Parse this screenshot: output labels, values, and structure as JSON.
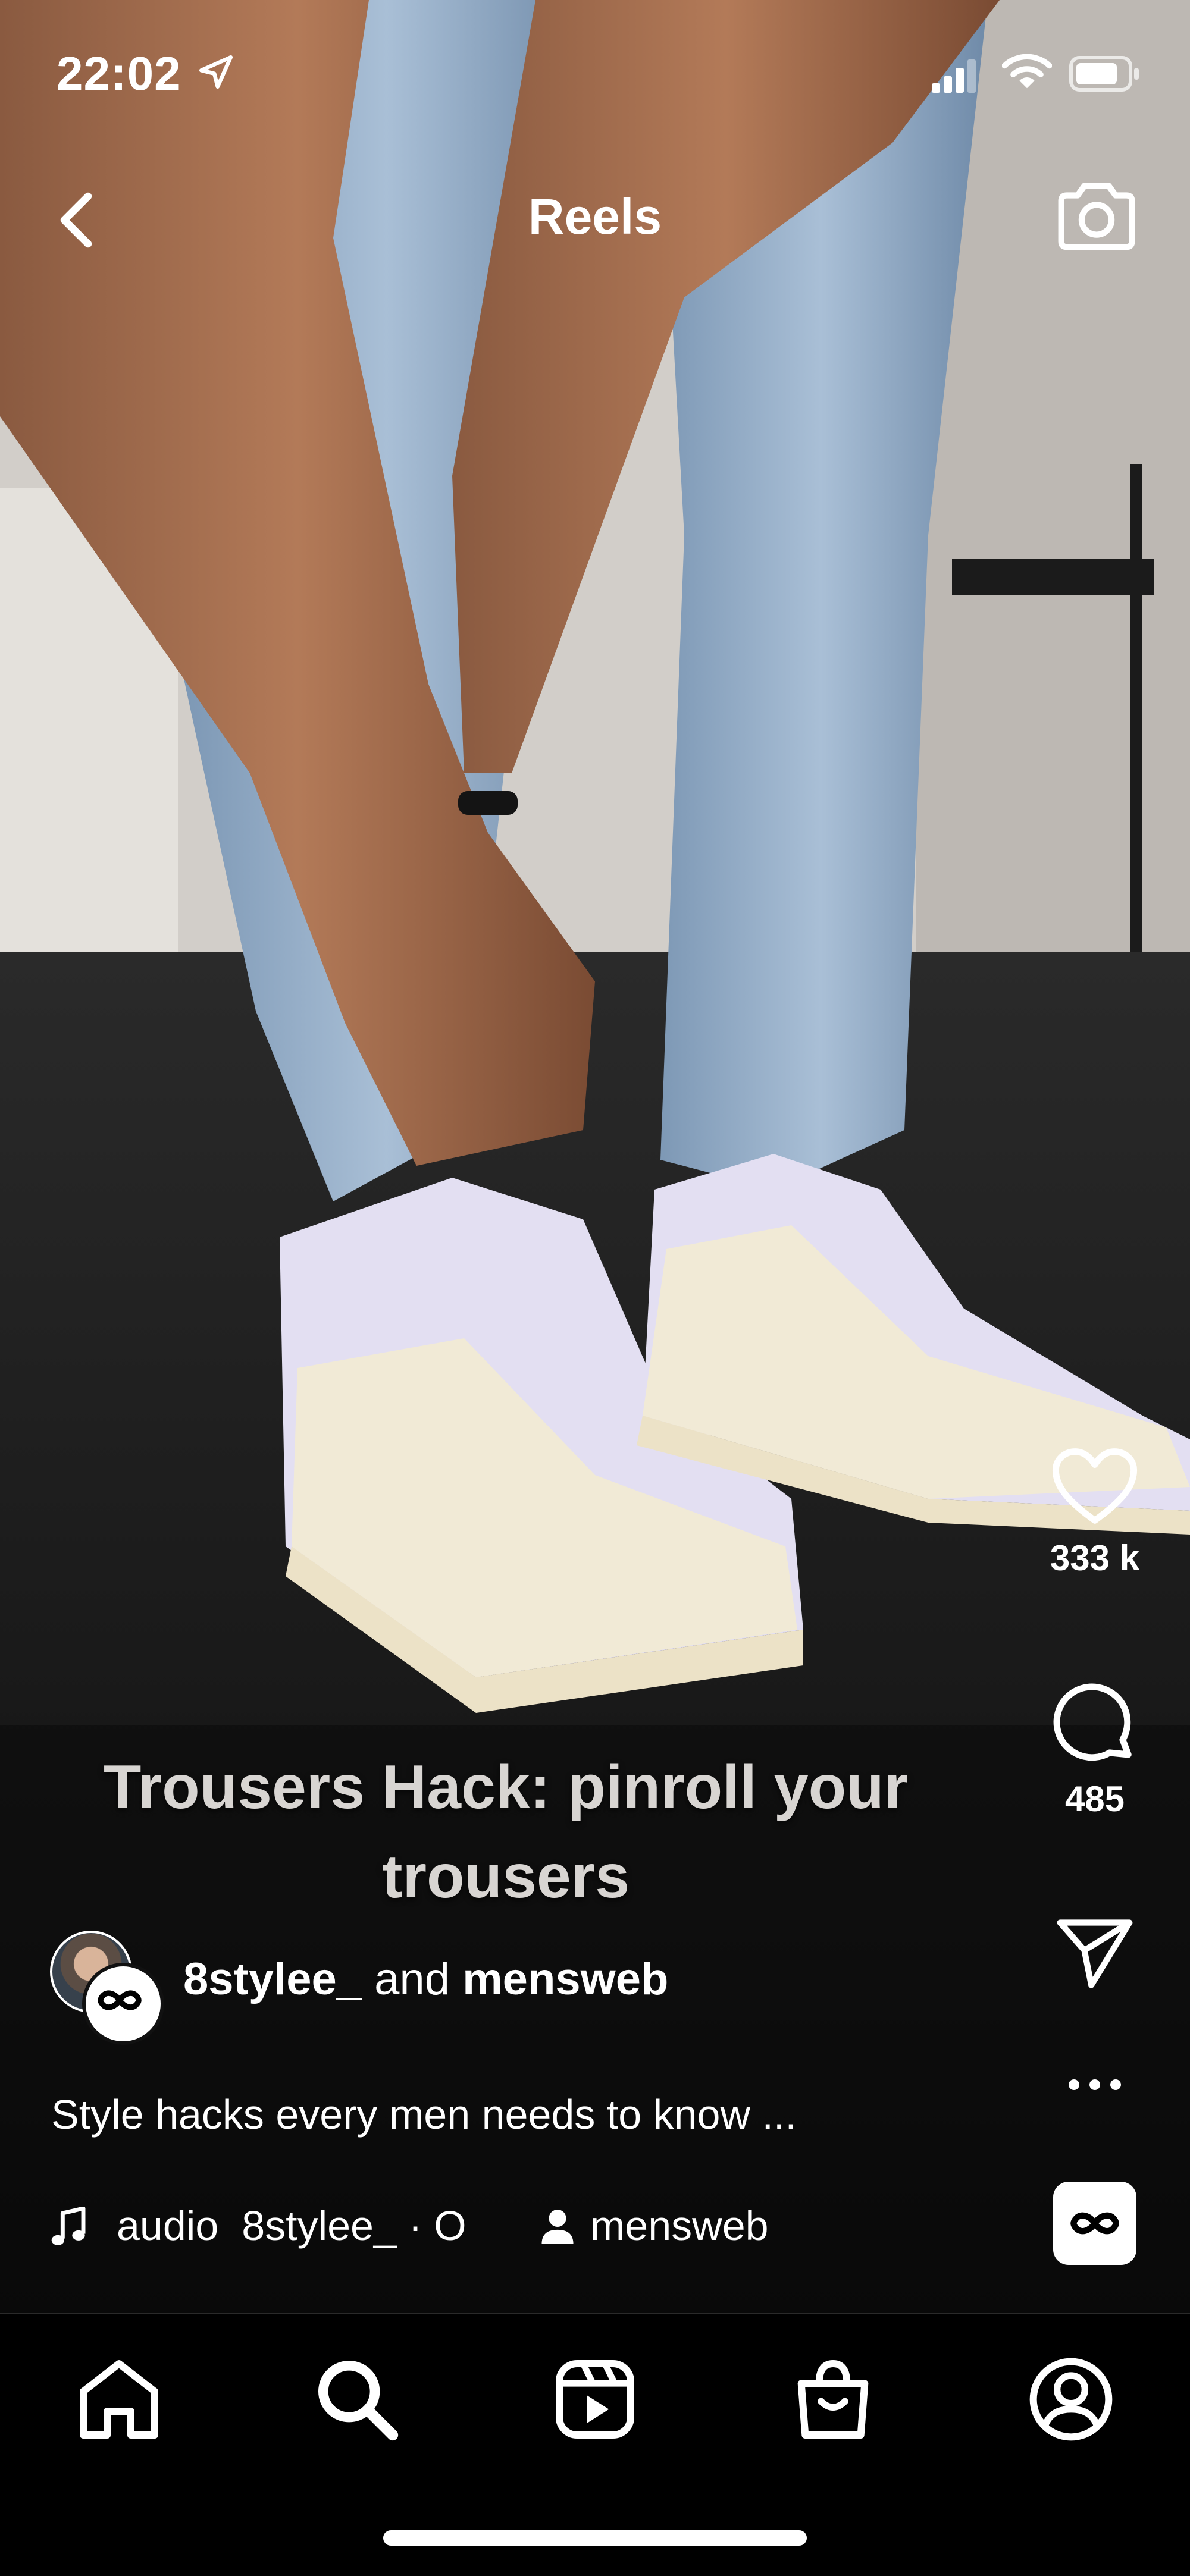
{
  "status_bar": {
    "time": "22:02",
    "location_icon": "location-arrow-icon",
    "signal_icon": "cellular-signal-icon",
    "wifi_icon": "wifi-icon",
    "battery_icon": "battery-icon"
  },
  "header": {
    "title": "Reels",
    "back_icon": "chevron-left-icon",
    "camera_icon": "camera-icon"
  },
  "video": {
    "caption_line1": "Trousers Hack: pinroll your",
    "caption_line2": "trousers"
  },
  "actions": {
    "like_count": "333 k",
    "comment_count": "485",
    "icons": [
      "heart-icon",
      "comment-icon",
      "send-icon",
      "more-icon",
      "infinity-icon"
    ]
  },
  "post": {
    "author1": "8stylee_",
    "connector": "and",
    "author2": "mensweb",
    "description": "Style hacks every men needs to know ...",
    "audio_label": "audio",
    "audio_source": "8stylee_ · O",
    "tagged_user": "mensweb"
  },
  "tab_bar": {
    "tabs": [
      "home",
      "search",
      "reels",
      "shop",
      "profile"
    ]
  },
  "colors": {
    "background": "#000000",
    "text": "#ffffff",
    "caption": "#d8d5d2"
  }
}
